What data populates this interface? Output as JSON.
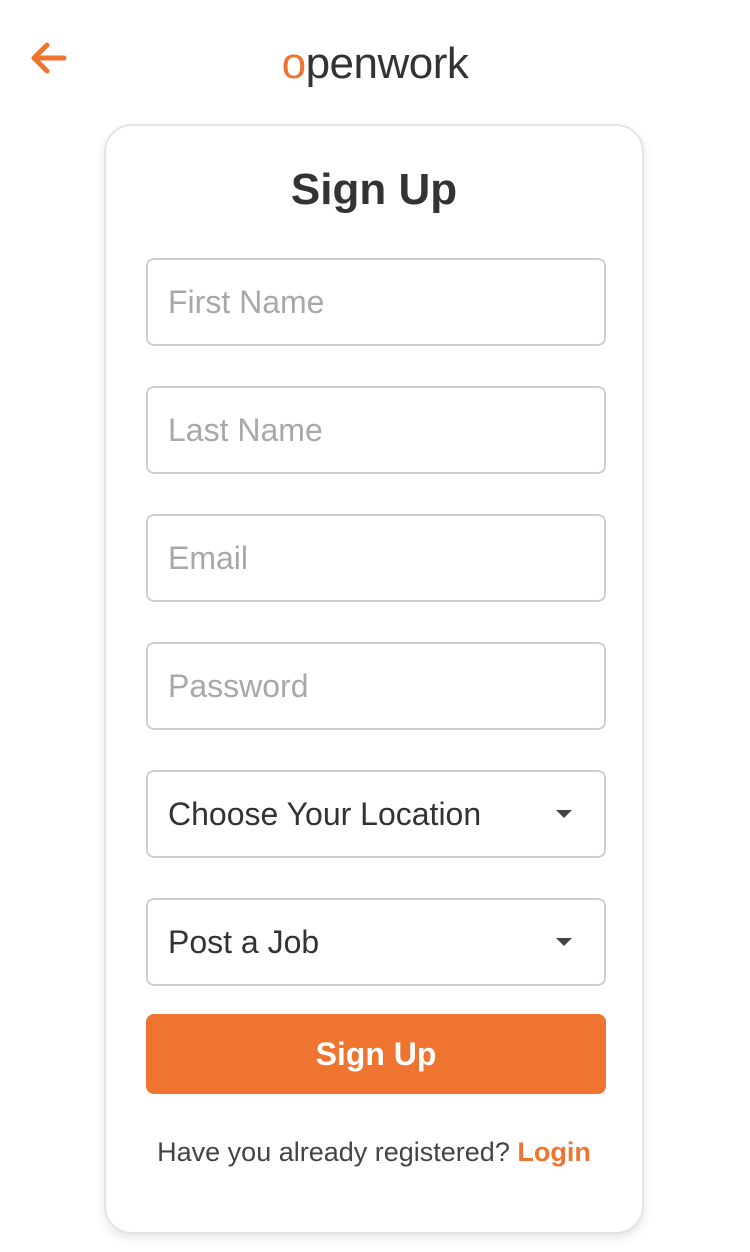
{
  "header": {
    "back_icon": "arrow-left-icon",
    "logo_first_letter": "o",
    "logo_rest": "penwork"
  },
  "colors": {
    "accent": "#ee7430",
    "text": "#333333",
    "placeholder": "#a8a8a8",
    "border": "#cfcfcf"
  },
  "form": {
    "title": "Sign Up",
    "first_name": {
      "placeholder": "First Name",
      "value": ""
    },
    "last_name": {
      "placeholder": "Last Name",
      "value": ""
    },
    "email": {
      "placeholder": "Email",
      "value": ""
    },
    "password": {
      "placeholder": "Password",
      "value": ""
    },
    "location_select": {
      "selected": "Choose Your Location",
      "icon": "caret-down-icon"
    },
    "role_select": {
      "selected": "Post a Job",
      "icon": "caret-down-icon"
    },
    "submit_label": "Sign Up",
    "footer_text": "Have you already registered?",
    "login_link": "Login"
  }
}
